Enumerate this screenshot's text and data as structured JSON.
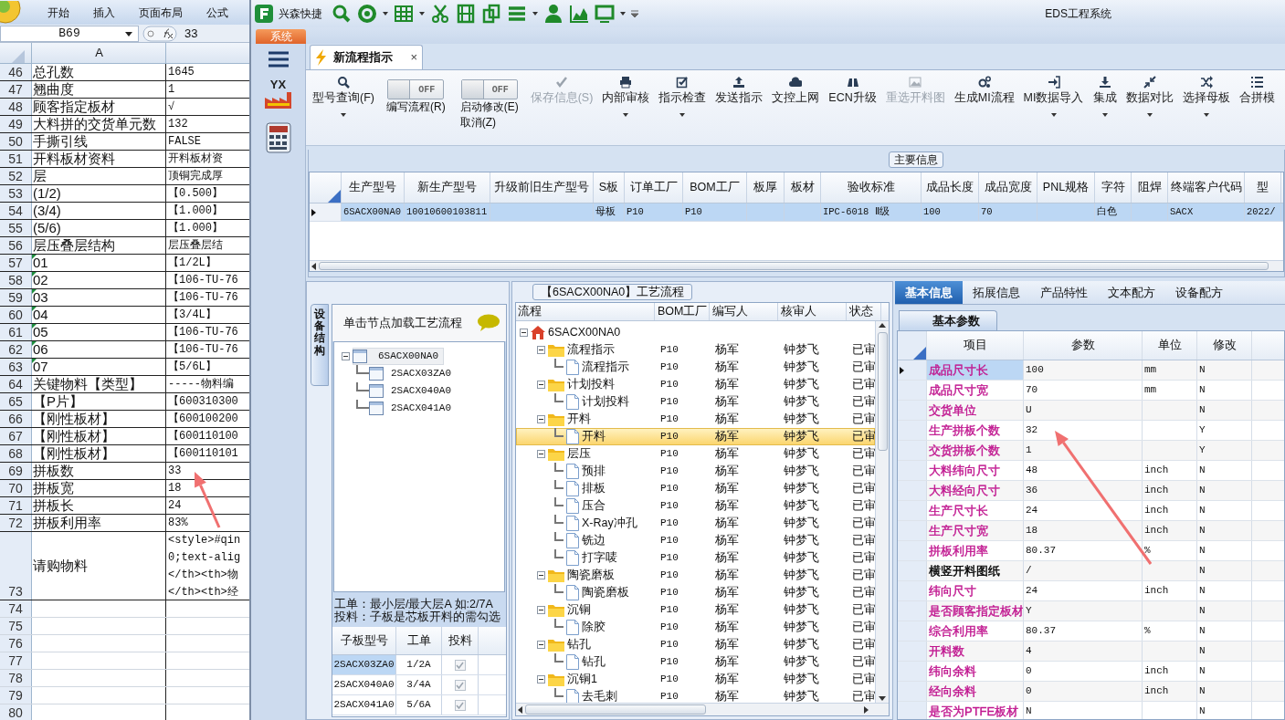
{
  "spreadsheet": {
    "ribbon_tabs": [
      "开始",
      "插入",
      "页面布局",
      "公式"
    ],
    "name_box": "B69",
    "formula_value": "33",
    "column_header": "A",
    "rows": [
      {
        "num": "46",
        "a": "总孔数",
        "b": "1645",
        "flag": false
      },
      {
        "num": "47",
        "a": "翘曲度",
        "b": "1",
        "flag": false
      },
      {
        "num": "48",
        "a": "顾客指定板材",
        "b": "√",
        "flag": false
      },
      {
        "num": "49",
        "a": "大料拼的交货单元数",
        "b": "132",
        "flag": false
      },
      {
        "num": "50",
        "a": "手撕引线",
        "b": "FALSE",
        "flag": false
      },
      {
        "num": "51",
        "a": "开料板材资料",
        "b": "开料板材资",
        "flag": false
      },
      {
        "num": "52",
        "a": "层",
        "b": "顶铜完成厚",
        "flag": false
      },
      {
        "num": "53",
        "a": "(1/2)",
        "b": "【0.500】",
        "flag": false
      },
      {
        "num": "54",
        "a": "(3/4)",
        "b": "【1.000】",
        "flag": false
      },
      {
        "num": "55",
        "a": "(5/6)",
        "b": "【1.000】",
        "flag": false
      },
      {
        "num": "56",
        "a": "层压叠层结构",
        "b": "层压叠层结",
        "flag": false
      },
      {
        "num": "57",
        "a": "01",
        "b": "【1/2L】",
        "flag": true
      },
      {
        "num": "58",
        "a": "02",
        "b": "【106-TU-76",
        "flag": true
      },
      {
        "num": "59",
        "a": "03",
        "b": "【106-TU-76",
        "flag": true
      },
      {
        "num": "60",
        "a": "04",
        "b": "【3/4L】",
        "flag": true
      },
      {
        "num": "61",
        "a": "05",
        "b": "【106-TU-76",
        "flag": true
      },
      {
        "num": "62",
        "a": "06",
        "b": "【106-TU-76",
        "flag": true
      },
      {
        "num": "63",
        "a": "07",
        "b": "【5/6L】",
        "flag": true
      },
      {
        "num": "64",
        "a": "关键物料【类型】",
        "b": "-----物料编",
        "flag": false
      },
      {
        "num": "65",
        "a": "【P片】",
        "b": "【600310300",
        "flag": false
      },
      {
        "num": "66",
        "a": "【刚性板材】",
        "b": "【600100200",
        "flag": false
      },
      {
        "num": "67",
        "a": "【刚性板材】",
        "b": "【600110100",
        "flag": false
      },
      {
        "num": "68",
        "a": "【刚性板材】",
        "b": "【600110101",
        "flag": false
      },
      {
        "num": "69",
        "a": "拼板数",
        "b": "33",
        "flag": false
      },
      {
        "num": "70",
        "a": "拼板宽",
        "b": "18",
        "flag": false
      },
      {
        "num": "71",
        "a": "拼板长",
        "b": "24",
        "flag": false
      },
      {
        "num": "72",
        "a": "拼板利用率",
        "b": "83%",
        "flag": false
      },
      {
        "num": "73",
        "a": "请购物料",
        "b": "<style>#qin\n0;text-alig\n</th><th>物\n</th><th>经",
        "flag": false
      },
      {
        "num": "74",
        "flag": false
      },
      {
        "num": "75",
        "flag": false
      },
      {
        "num": "76",
        "flag": false
      },
      {
        "num": "77",
        "flag": false
      },
      {
        "num": "78",
        "flag": false
      },
      {
        "num": "79",
        "flag": false
      },
      {
        "num": "80",
        "flag": false
      }
    ]
  },
  "app": {
    "title": "EDS工程系统",
    "quick_label": "兴森快捷",
    "system_tab": "系统",
    "logo_text": "YX",
    "doc_tab": {
      "label": "新流程指示",
      "close": "×"
    },
    "ribbon": [
      {
        "kind": "button",
        "label": "型号查询(F)",
        "dropdown": true,
        "disabled": false
      },
      {
        "kind": "toggle",
        "switch_text": "OFF",
        "on": false,
        "label": "编写流程(R)"
      },
      {
        "kind": "toggle",
        "switch_text": "OFF",
        "on": false,
        "label": "启动修改(E)\n取消(Z)"
      },
      {
        "kind": "button",
        "label": "保存信息(S)",
        "dropdown": false,
        "disabled": true
      },
      {
        "kind": "button",
        "label": "内部审核",
        "dropdown": true,
        "disabled": false
      },
      {
        "kind": "button",
        "label": "指示检查",
        "dropdown": true,
        "disabled": false
      },
      {
        "kind": "button",
        "label": "发送指示",
        "dropdown": false,
        "disabled": false
      },
      {
        "kind": "button",
        "label": "文控上网",
        "dropdown": false,
        "disabled": false
      },
      {
        "kind": "button",
        "label": "ECN升级",
        "dropdown": false,
        "disabled": false
      },
      {
        "kind": "button",
        "label": "重选开料图",
        "dropdown": false,
        "disabled": true
      },
      {
        "kind": "button",
        "label": "生成MI流程",
        "dropdown": false,
        "disabled": false
      },
      {
        "kind": "button",
        "label": "MI数据导入",
        "dropdown": true,
        "disabled": false
      },
      {
        "kind": "button",
        "label": "集成",
        "dropdown": true,
        "disabled": false
      },
      {
        "kind": "button",
        "label": "数据对比",
        "dropdown": true,
        "disabled": false
      },
      {
        "kind": "button",
        "label": "选择母板",
        "dropdown": true,
        "disabled": false
      },
      {
        "kind": "button",
        "label": "合拼模",
        "dropdown": false,
        "disabled": false
      }
    ],
    "main_info": {
      "title": "主要信息",
      "columns": [
        "生产型号",
        "新生产型号",
        "升级前旧生产型号",
        "S板",
        "订单工厂",
        "BOM工厂",
        "板厚",
        "板材",
        "验收标准",
        "成品长度",
        "成品宽度",
        "PNL规格",
        "字符",
        "阻焊",
        "终端客户代码",
        "型"
      ],
      "rows": [
        {
          "selected": true,
          "cells": [
            "6SACX00NA0",
            "10010600103811",
            null,
            "母板",
            "P10",
            "P10",
            null,
            null,
            "IPC-6018 Ⅱ级",
            "100",
            "70",
            null,
            "白色",
            null,
            "SACX",
            "2022/"
          ]
        }
      ]
    },
    "device_panel": {
      "side_tab": "设备结构",
      "hint": "单击节点加载工艺流程",
      "tree": [
        {
          "label": "6SACX00NA0",
          "expanded": true,
          "selected": true,
          "children": [
            {
              "label": "2SACX03ZA0",
              "selected": false
            },
            {
              "label": "2SACX040A0",
              "selected": false
            },
            {
              "label": "2SACX041A0",
              "selected": false
            }
          ]
        }
      ],
      "notes": [
        "工单：最小层/最大层A 如:2/7A",
        "投料：子板是芯板开料的需勾选"
      ],
      "sub_columns": [
        "子板型号",
        "工单",
        "投料"
      ],
      "sub_rows": [
        {
          "model": "2SACX03ZA0",
          "order": "1/2A",
          "checked": true,
          "selected": true
        },
        {
          "model": "2SACX040A0",
          "order": "3/4A",
          "checked": true,
          "selected": false
        },
        {
          "model": "2SACX041A0",
          "order": "5/6A",
          "checked": true,
          "selected": false
        }
      ]
    },
    "flow": {
      "title": "【6SACX00NA0】工艺流程",
      "columns": [
        "流程",
        "BOM工厂",
        "编写人",
        "核审人",
        "状态"
      ],
      "tree": [
        {
          "kind": "root",
          "label": "6SACX00NA0",
          "expanded": true,
          "selected": false,
          "children": [
            {
              "kind": "folder",
              "label": "流程指示",
              "bom": "P10",
              "writer": "杨军",
              "reviewer": "钟梦飞",
              "status": "已审",
              "expanded": true,
              "selected": false,
              "children": [
                {
                  "kind": "doc",
                  "label": "流程指示",
                  "bom": "P10",
                  "writer": "杨军",
                  "reviewer": "钟梦飞",
                  "status": "已审",
                  "selected": false
                }
              ]
            },
            {
              "kind": "folder",
              "label": "计划投料",
              "bom": "P10",
              "writer": "杨军",
              "reviewer": "钟梦飞",
              "status": "已审",
              "expanded": true,
              "selected": false,
              "children": [
                {
                  "kind": "doc",
                  "label": "计划投料",
                  "bom": "P10",
                  "writer": "杨军",
                  "reviewer": "钟梦飞",
                  "status": "已审",
                  "selected": false
                }
              ]
            },
            {
              "kind": "folder",
              "label": "开料",
              "bom": "P10",
              "writer": "杨军",
              "reviewer": "钟梦飞",
              "status": "已审",
              "expanded": true,
              "selected": false,
              "children": [
                {
                  "kind": "doc",
                  "label": "开料",
                  "bom": "P10",
                  "writer": "杨军",
                  "reviewer": "钟梦飞",
                  "status": "已审",
                  "selected": true
                }
              ]
            },
            {
              "kind": "folder",
              "label": "层压",
              "bom": "P10",
              "writer": "杨军",
              "reviewer": "钟梦飞",
              "status": "已审",
              "expanded": true,
              "selected": false,
              "children": [
                {
                  "kind": "doc",
                  "label": "预排",
                  "bom": "P10",
                  "writer": "杨军",
                  "reviewer": "钟梦飞",
                  "status": "已审",
                  "selected": false
                },
                {
                  "kind": "doc",
                  "label": "排板",
                  "bom": "P10",
                  "writer": "杨军",
                  "reviewer": "钟梦飞",
                  "status": "已审",
                  "selected": false
                },
                {
                  "kind": "doc",
                  "label": "压合",
                  "bom": "P10",
                  "writer": "杨军",
                  "reviewer": "钟梦飞",
                  "status": "已审",
                  "selected": false
                },
                {
                  "kind": "doc",
                  "label": "X-Ray冲孔",
                  "bom": "P10",
                  "writer": "杨军",
                  "reviewer": "钟梦飞",
                  "status": "已审",
                  "selected": false
                },
                {
                  "kind": "doc",
                  "label": "铣边",
                  "bom": "P10",
                  "writer": "杨军",
                  "reviewer": "钟梦飞",
                  "status": "已审",
                  "selected": false
                },
                {
                  "kind": "doc",
                  "label": "打字唛",
                  "bom": "P10",
                  "writer": "杨军",
                  "reviewer": "钟梦飞",
                  "status": "已审",
                  "selected": false
                }
              ]
            },
            {
              "kind": "folder",
              "label": "陶瓷磨板",
              "bom": "P10",
              "writer": "杨军",
              "reviewer": "钟梦飞",
              "status": "已审",
              "expanded": true,
              "selected": false,
              "children": [
                {
                  "kind": "doc",
                  "label": "陶瓷磨板",
                  "bom": "P10",
                  "writer": "杨军",
                  "reviewer": "钟梦飞",
                  "status": "已审",
                  "selected": false
                }
              ]
            },
            {
              "kind": "folder",
              "label": "沉铜",
              "bom": "P10",
              "writer": "杨军",
              "reviewer": "钟梦飞",
              "status": "已审",
              "expanded": true,
              "selected": false,
              "children": [
                {
                  "kind": "doc",
                  "label": "除胶",
                  "bom": "P10",
                  "writer": "杨军",
                  "reviewer": "钟梦飞",
                  "status": "已审",
                  "selected": false
                }
              ]
            },
            {
              "kind": "folder",
              "label": "钻孔",
              "bom": "P10",
              "writer": "杨军",
              "reviewer": "钟梦飞",
              "status": "已审",
              "expanded": true,
              "selected": false,
              "children": [
                {
                  "kind": "doc",
                  "label": "钻孔",
                  "bom": "P10",
                  "writer": "杨军",
                  "reviewer": "钟梦飞",
                  "status": "已审",
                  "selected": false
                }
              ]
            },
            {
              "kind": "folder",
              "label": "沉铜1",
              "bom": "P10",
              "writer": "杨军",
              "reviewer": "钟梦飞",
              "status": "已审",
              "expanded": true,
              "selected": false,
              "children": [
                {
                  "kind": "doc",
                  "label": "去毛刺",
                  "bom": "P10",
                  "writer": "杨军",
                  "reviewer": "钟梦飞",
                  "status": "已审",
                  "selected": false
                }
              ]
            }
          ]
        }
      ]
    },
    "params": {
      "tabs": [
        {
          "label": "基本信息",
          "selected": true
        },
        {
          "label": "拓展信息",
          "selected": false
        },
        {
          "label": "产品特性",
          "selected": false
        },
        {
          "label": "文本配方",
          "selected": false
        },
        {
          "label": "设备配方",
          "selected": false
        }
      ],
      "sub_tab": "基本参数",
      "columns": [
        "项目",
        "参数",
        "单位",
        "修改"
      ],
      "rows": [
        {
          "item": "成品尺寸长",
          "color": "#c0168f",
          "value": "100",
          "unit": "mm",
          "modified": "N",
          "selected": true
        },
        {
          "item": "成品尺寸宽",
          "color": "#c0168f",
          "value": "70",
          "unit": "mm",
          "modified": "N",
          "selected": false
        },
        {
          "item": "交货单位",
          "color": "#c0168f",
          "value": "U",
          "modified": "N",
          "selected": false
        },
        {
          "item": "生产拼板个数",
          "color": "#c0168f",
          "value": "32",
          "modified": "Y",
          "selected": false
        },
        {
          "item": "交货拼板个数",
          "color": "#c0168f",
          "value": "1",
          "modified": "Y",
          "selected": false
        },
        {
          "item": "大料纬向尺寸",
          "color": "#c0168f",
          "value": "48",
          "unit": "inch",
          "modified": "N",
          "selected": false
        },
        {
          "item": "大料经向尺寸",
          "color": "#c0168f",
          "value": "36",
          "unit": "inch",
          "modified": "N",
          "selected": false
        },
        {
          "item": "生产尺寸长",
          "color": "#c0168f",
          "value": "24",
          "unit": "inch",
          "modified": "N",
          "selected": false
        },
        {
          "item": "生产尺寸宽",
          "color": "#c0168f",
          "value": "18",
          "unit": "inch",
          "modified": "N",
          "selected": false
        },
        {
          "item": "拼板利用率",
          "color": "#c0168f",
          "value": "80.37",
          "unit": "%",
          "modified": "N",
          "selected": false
        },
        {
          "item": "横竖开料图纸",
          "color": "#000000",
          "value": "/",
          "modified": "N",
          "selected": false
        },
        {
          "item": "纬向尺寸",
          "color": "#c0168f",
          "value": "24",
          "unit": "inch",
          "modified": "N",
          "selected": false
        },
        {
          "item": "是否顾客指定板材",
          "color": "#c0168f",
          "value": "Y",
          "modified": "N",
          "selected": false
        },
        {
          "item": "综合利用率",
          "color": "#c0168f",
          "value": "80.37",
          "unit": "%",
          "modified": "N",
          "selected": false
        },
        {
          "item": "开料数",
          "color": "#c0168f",
          "value": "4",
          "modified": "N",
          "selected": false
        },
        {
          "item": "纬向余料",
          "color": "#c0168f",
          "value": "0",
          "unit": "inch",
          "modified": "N",
          "selected": false
        },
        {
          "item": "经向余料",
          "color": "#c0168f",
          "value": "0",
          "unit": "inch",
          "modified": "N",
          "selected": false
        },
        {
          "item": "是否为PTFE板材",
          "color": "#c0168f",
          "value": "N",
          "modified": "N",
          "selected": false
        }
      ]
    },
    "markup": [
      {
        "kind": "arrow"
      },
      {
        "kind": "arrow"
      }
    ]
  }
}
